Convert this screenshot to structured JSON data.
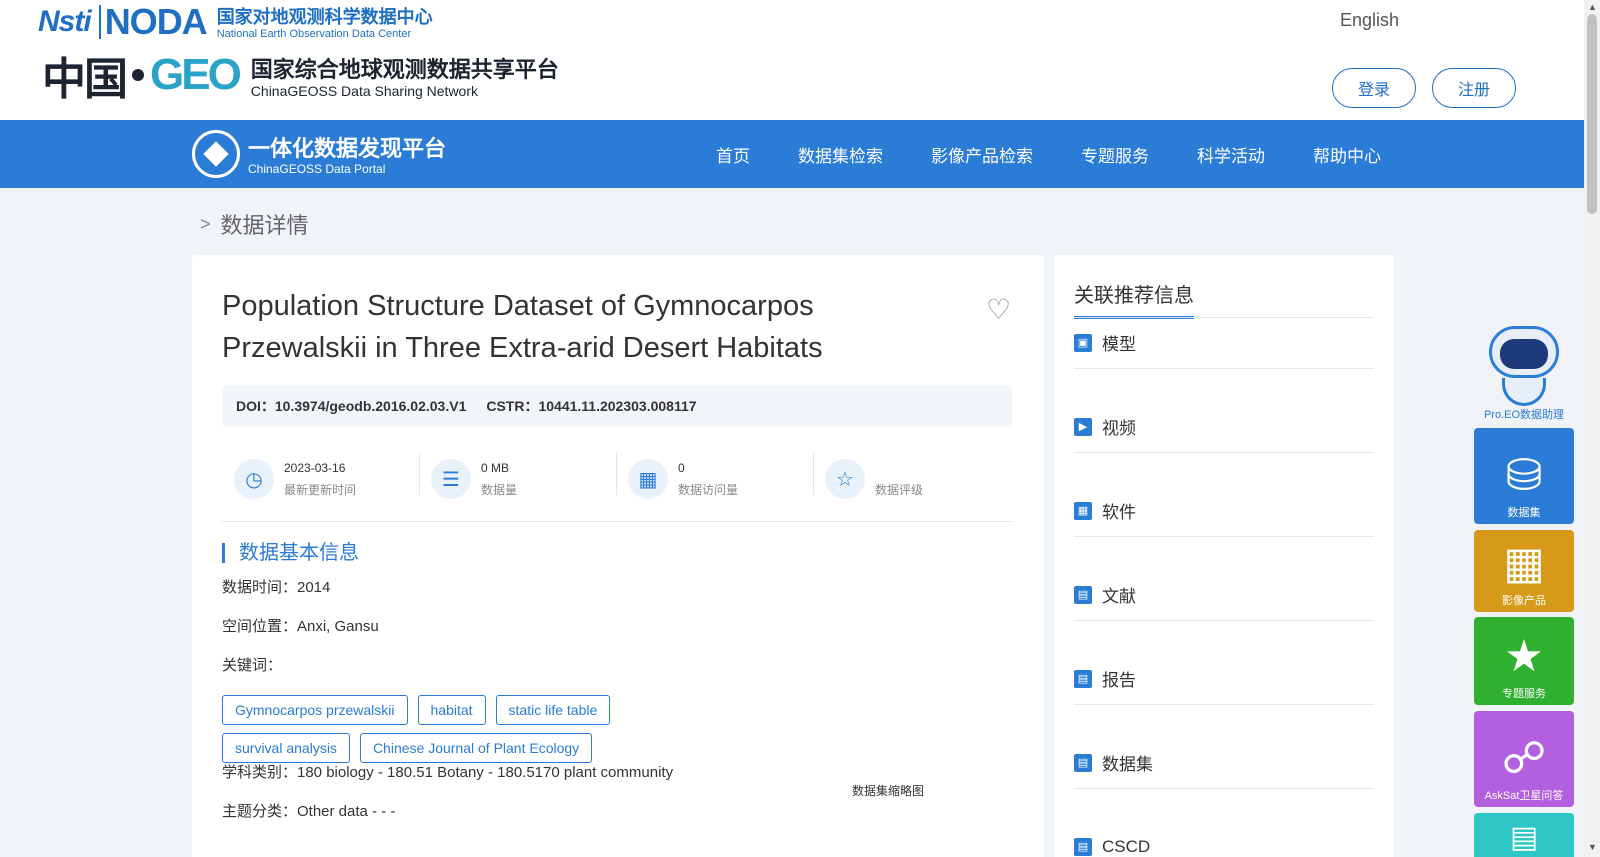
{
  "header": {
    "noda_mark_1": "Nsti",
    "noda_mark_2": "NODA",
    "noda_cn": "国家对地观测科学数据中心",
    "noda_en": "National Earth Observation Data Center",
    "geoss_mark_1": "中国",
    "geoss_mark_2": "GEO",
    "geoss_cn": "国家综合地球观测数据共享平台",
    "geoss_en": "ChinaGEOSS Data Sharing Network",
    "language": "English",
    "login": "登录",
    "register": "注册"
  },
  "navbar": {
    "portal_cn": "一体化数据发现平台",
    "portal_en": "ChinaGEOSS Data Portal",
    "items": [
      "首页",
      "数据集检索",
      "影像产品检索",
      "专题服务",
      "科学活动",
      "帮助中心"
    ]
  },
  "breadcrumb": "数据详情",
  "dataset": {
    "title": "Population Structure Dataset of Gymnocarpos Przewalskii in Three Extra-arid Desert Habitats",
    "doi": "DOI：10.3974/geodb.2016.02.03.V1",
    "cstr": "CSTR：10441.11.202303.008117",
    "stats": [
      {
        "value": "2023-03-16",
        "label": "最新更新时间",
        "icon": "clock-icon"
      },
      {
        "value": "0 MB",
        "label": "数据量",
        "icon": "layers-icon"
      },
      {
        "value": "0",
        "label": "数据访问量",
        "icon": "bar-chart-icon"
      },
      {
        "value": "",
        "label": "数据评级",
        "icon": "star-icon"
      }
    ],
    "section_title": "数据基本信息",
    "time": "数据时间：2014",
    "location": "空间位置：Anxi, Gansu",
    "keywords_label": "关键词：",
    "keywords": [
      "Gymnocarpos przewalskii",
      "habitat",
      "static life table",
      "survival analysis",
      "Chinese Journal of Plant Ecology"
    ],
    "discipline": "学科类别：180 biology - 180.51 Botany - 180.5170 plant community",
    "theme": "主题分类：Other data - - -",
    "thumbnail_label": "数据集缩略图"
  },
  "related": {
    "title": "关联推荐信息",
    "items": [
      "模型",
      "视频",
      "软件",
      "文献",
      "报告",
      "数据集",
      "CSCD"
    ]
  },
  "float_sidebar": {
    "assistant": "Pro.EO数据助理",
    "items": [
      {
        "label": "数据集",
        "color": "#2a7cd6"
      },
      {
        "label": "影像产品",
        "color": "#d79a18"
      },
      {
        "label": "专题服务",
        "color": "#2fb12f"
      },
      {
        "label": "AskSat卫星问答",
        "color": "#b25fe0"
      },
      {
        "label": "",
        "color": "#2fc6c6"
      }
    ]
  }
}
